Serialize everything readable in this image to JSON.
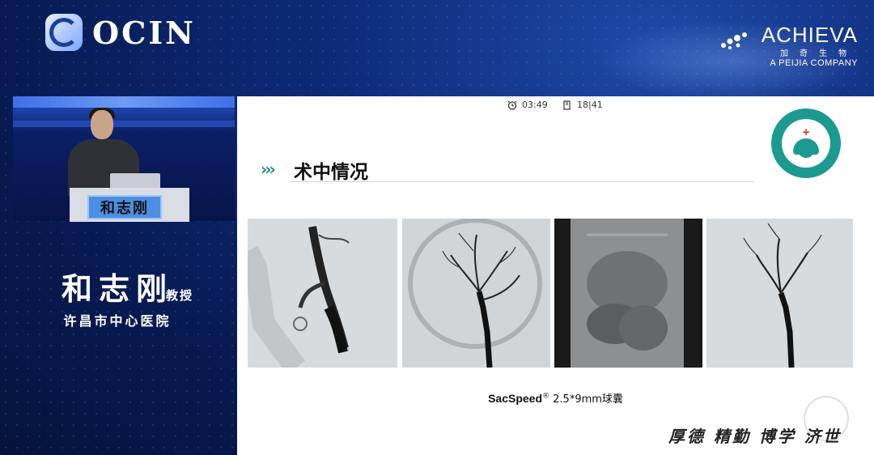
{
  "header": {
    "left_logo_text": "OCIN",
    "right_logo": {
      "main": "ACHIEVA",
      "cn": "加奇生物",
      "sub": "A PEIJIA COMPANY"
    }
  },
  "video": {
    "podium_sign": "和志刚"
  },
  "speaker": {
    "name": "和志刚",
    "title": "教授",
    "hospital": "许昌市中心医院"
  },
  "slide": {
    "timer": "03:49",
    "page": "18|41",
    "section_arrows": "›››",
    "section_title": "术中情况",
    "caption_brand": "SacSpeed",
    "caption_reg": "®",
    "caption_rest": " 2.5*9mm球囊",
    "motto": "厚德 精勤 博学 济世"
  },
  "icons": [
    "alarm-clock-icon",
    "page-icon",
    "hospital-logo-icon"
  ]
}
